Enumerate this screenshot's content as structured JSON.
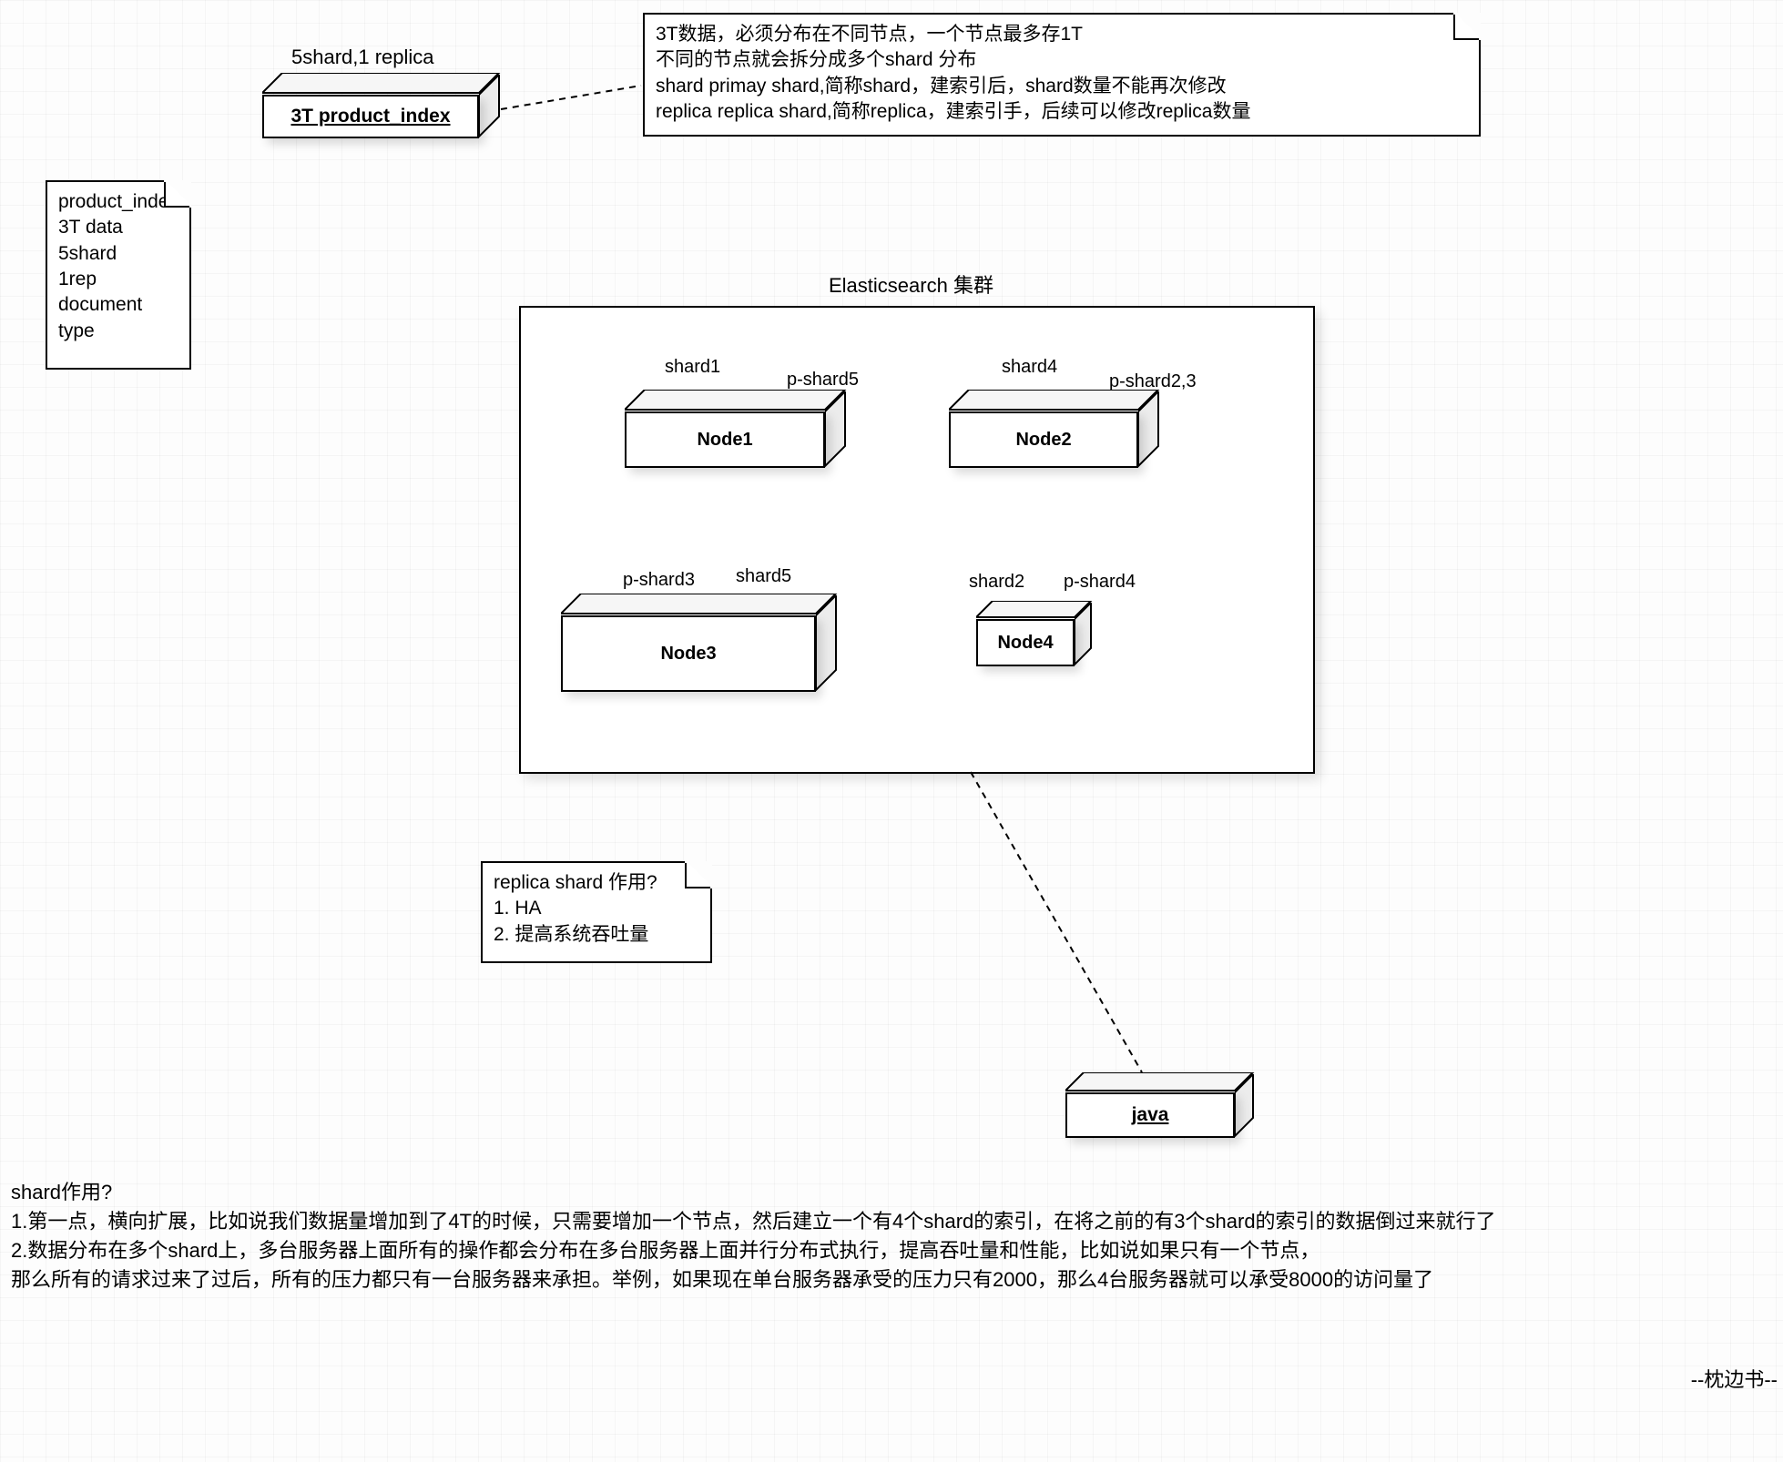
{
  "index_box": {
    "label": "3T product_index",
    "caption": "5shard,1 replica"
  },
  "top_note": {
    "l1": "3T数据，必须分布在不同节点，一个节点最多存1T",
    "l2": "不同的节点就会拆分成多个shard 分布",
    "l3": "shard primay shard,简称shard，建索引后，shard数量不能再次修改",
    "l4": "replica replica shard,简称replica，建索引手，后续可以修改replica数量"
  },
  "left_note": {
    "l1": "product_index",
    "l2": "3T data",
    "l3": "5shard",
    "l4": "1rep",
    "l5": "document",
    "l6": "type"
  },
  "cluster": {
    "title": "Elasticsearch 集群",
    "nodes": {
      "n1": {
        "name": "Node1",
        "top_left": "shard1",
        "top_right": "p-shard5"
      },
      "n2": {
        "name": "Node2",
        "top_left": "shard4",
        "top_right": "p-shard2,3"
      },
      "n3": {
        "name": "Node3",
        "top_left": "p-shard3",
        "top_right": "shard5"
      },
      "n4": {
        "name": "Node4",
        "top_left": "shard2",
        "top_right": "p-shard4"
      }
    }
  },
  "replica_note": {
    "l1": "replica shard 作用?",
    "l2": "1. HA",
    "l3": "2. 提高系统吞吐量"
  },
  "java_box": {
    "label": "java"
  },
  "bottom_text": {
    "l1": "shard作用?",
    "l2": "1.第一点，横向扩展，比如说我们数据量增加到了4T的时候，只需要增加一个节点，然后建立一个有4个shard的索引，在将之前的有3个shard的索引的数据倒过来就行了",
    "l3": "2.数据分布在多个shard上，多台服务器上面所有的操作都会分布在多台服务器上面并行分布式执行，提高吞吐量和性能，比如说如果只有一个节点，",
    "l4": "那么所有的请求过来了过后，所有的压力都只有一台服务器来承担。举例，如果现在单台服务器承受的压力只有2000，那么4台服务器就可以承受8000的访问量了"
  },
  "signature": "--枕边书--"
}
